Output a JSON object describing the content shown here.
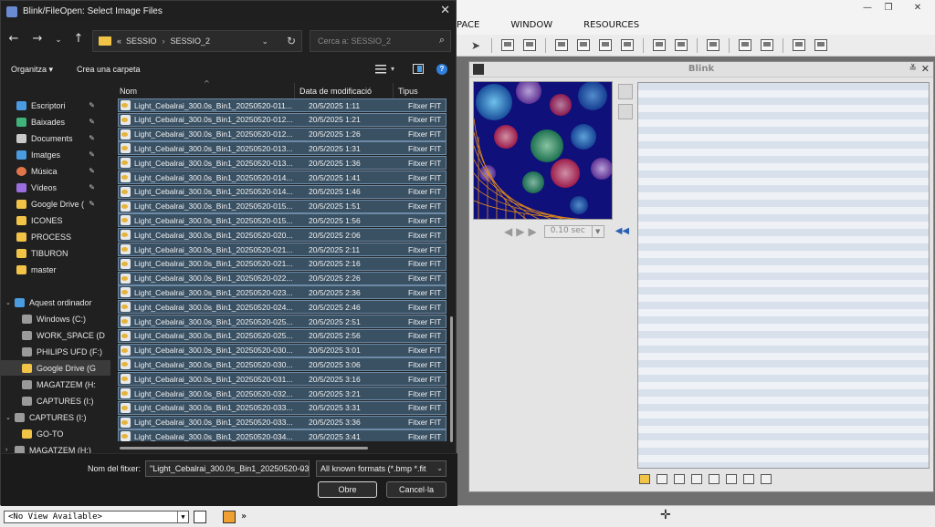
{
  "dialog": {
    "title": "Blink/FileOpen: Select Image Files",
    "address": {
      "prefix": "«",
      "parts": [
        "SESSIO",
        "SESSIO_2"
      ],
      "separator": "›"
    },
    "search_placeholder": "Cerca a: SESSIO_2",
    "command_bar": {
      "organize": "Organitza",
      "organize_caret": "▾",
      "new_folder": "Crea una carpeta"
    },
    "nav_pane": [
      {
        "label": "Escriptori",
        "pinned": true,
        "icon": "desktop-icon",
        "color": "#4a9be0"
      },
      {
        "label": "Baixades",
        "pinned": true,
        "icon": "download-icon",
        "color": "#3fb37a"
      },
      {
        "label": "Documents",
        "pinned": true,
        "icon": "document-icon",
        "color": "#c9c9c9"
      },
      {
        "label": "Imatges",
        "pinned": true,
        "icon": "image-icon",
        "color": "#4a9be0"
      },
      {
        "label": "Música",
        "pinned": true,
        "icon": "music-icon",
        "color": "#e0744a"
      },
      {
        "label": "Vídeos",
        "pinned": true,
        "icon": "video-icon",
        "color": "#9b6ee0"
      },
      {
        "label": "Google Drive (",
        "pinned": true,
        "icon": "google-drive-icon",
        "color": "#f1c447"
      },
      {
        "label": "ICONES",
        "pinned": false,
        "icon": "folder-icon",
        "color": "#f1c447"
      },
      {
        "label": "PROCESS",
        "pinned": false,
        "icon": "folder-icon",
        "color": "#f1c447"
      },
      {
        "label": "TIBURON",
        "pinned": false,
        "icon": "folder-icon",
        "color": "#f1c447"
      },
      {
        "label": "master",
        "pinned": false,
        "icon": "folder-icon",
        "color": "#f1c447"
      },
      {
        "label": "Aquest ordinador",
        "pinned": false,
        "icon": "computer-icon",
        "color": "#4a9be0"
      },
      {
        "label": "Windows (C:)",
        "pinned": false,
        "icon": "drive-icon",
        "color": "#9a9a9a"
      },
      {
        "label": "WORK_SPACE (D",
        "pinned": false,
        "icon": "drive-icon",
        "color": "#9a9a9a"
      },
      {
        "label": "PHILIPS UFD (F:)",
        "pinned": false,
        "icon": "usb-drive-icon",
        "color": "#9a9a9a"
      },
      {
        "label": "Google Drive (G",
        "pinned": false,
        "icon": "google-drive-icon",
        "color": "#f1c447",
        "selected": true
      },
      {
        "label": "MAGATZEM (H:",
        "pinned": false,
        "icon": "drive-icon",
        "color": "#9a9a9a"
      },
      {
        "label": "CAPTURES (I:)",
        "pinned": false,
        "icon": "drive-icon",
        "color": "#9a9a9a"
      },
      {
        "label": "CAPTURES (I:)",
        "pinned": false,
        "icon": "drive-icon",
        "color": "#9a9a9a"
      },
      {
        "label": "GO-TO",
        "pinned": false,
        "icon": "folder-icon",
        "color": "#f1c447"
      },
      {
        "label": "MAGATZEM (H:)",
        "pinned": false,
        "icon": "drive-icon",
        "color": "#9a9a9a"
      }
    ],
    "columns": {
      "name": "Nom",
      "date": "Data de modificació",
      "type": "Tipus"
    },
    "files": [
      {
        "name": "Light_Cebalrai_300.0s_Bin1_20250520-011...",
        "date": "20/5/2025 1:11",
        "type": "Fitxer FIT"
      },
      {
        "name": "Light_Cebalrai_300.0s_Bin1_20250520-012...",
        "date": "20/5/2025 1:21",
        "type": "Fitxer FIT"
      },
      {
        "name": "Light_Cebalrai_300.0s_Bin1_20250520-012...",
        "date": "20/5/2025 1:26",
        "type": "Fitxer FIT"
      },
      {
        "name": "Light_Cebalrai_300.0s_Bin1_20250520-013...",
        "date": "20/5/2025 1:31",
        "type": "Fitxer FIT"
      },
      {
        "name": "Light_Cebalrai_300.0s_Bin1_20250520-013...",
        "date": "20/5/2025 1:36",
        "type": "Fitxer FIT"
      },
      {
        "name": "Light_Cebalrai_300.0s_Bin1_20250520-014...",
        "date": "20/5/2025 1:41",
        "type": "Fitxer FIT"
      },
      {
        "name": "Light_Cebalrai_300.0s_Bin1_20250520-014...",
        "date": "20/5/2025 1:46",
        "type": "Fitxer FIT"
      },
      {
        "name": "Light_Cebalrai_300.0s_Bin1_20250520-015...",
        "date": "20/5/2025 1:51",
        "type": "Fitxer FIT"
      },
      {
        "name": "Light_Cebalrai_300.0s_Bin1_20250520-015...",
        "date": "20/5/2025 1:56",
        "type": "Fitxer FIT"
      },
      {
        "name": "Light_Cebalrai_300.0s_Bin1_20250520-020...",
        "date": "20/5/2025 2:06",
        "type": "Fitxer FIT"
      },
      {
        "name": "Light_Cebalrai_300.0s_Bin1_20250520-021...",
        "date": "20/5/2025 2:11",
        "type": "Fitxer FIT"
      },
      {
        "name": "Light_Cebalrai_300.0s_Bin1_20250520-021...",
        "date": "20/5/2025 2:16",
        "type": "Fitxer FIT"
      },
      {
        "name": "Light_Cebalrai_300.0s_Bin1_20250520-022...",
        "date": "20/5/2025 2:26",
        "type": "Fitxer FIT"
      },
      {
        "name": "Light_Cebalrai_300.0s_Bin1_20250520-023...",
        "date": "20/5/2025 2:36",
        "type": "Fitxer FIT"
      },
      {
        "name": "Light_Cebalrai_300.0s_Bin1_20250520-024...",
        "date": "20/5/2025 2:46",
        "type": "Fitxer FIT"
      },
      {
        "name": "Light_Cebalrai_300.0s_Bin1_20250520-025...",
        "date": "20/5/2025 2:51",
        "type": "Fitxer FIT"
      },
      {
        "name": "Light_Cebalrai_300.0s_Bin1_20250520-025...",
        "date": "20/5/2025 2:56",
        "type": "Fitxer FIT"
      },
      {
        "name": "Light_Cebalrai_300.0s_Bin1_20250520-030...",
        "date": "20/5/2025 3:01",
        "type": "Fitxer FIT"
      },
      {
        "name": "Light_Cebalrai_300.0s_Bin1_20250520-030...",
        "date": "20/5/2025 3:06",
        "type": "Fitxer FIT"
      },
      {
        "name": "Light_Cebalrai_300.0s_Bin1_20250520-031...",
        "date": "20/5/2025 3:16",
        "type": "Fitxer FIT"
      },
      {
        "name": "Light_Cebalrai_300.0s_Bin1_20250520-032...",
        "date": "20/5/2025 3:21",
        "type": "Fitxer FIT"
      },
      {
        "name": "Light_Cebalrai_300.0s_Bin1_20250520-033...",
        "date": "20/5/2025 3:31",
        "type": "Fitxer FIT"
      },
      {
        "name": "Light_Cebalrai_300.0s_Bin1_20250520-033...",
        "date": "20/5/2025 3:36",
        "type": "Fitxer FIT"
      },
      {
        "name": "Light_Cebalrai_300.0s_Bin1_20250520-034...",
        "date": "20/5/2025 3:41",
        "type": "Fitxer FIT"
      }
    ],
    "footer": {
      "filename_label": "Nom del fitxer:",
      "filename_value": "\"Light_Cebalrai_300.0s_Bin1_20250520-03",
      "filter_value": "All known formats (*.bmp *.fit",
      "open_button": "Obre",
      "cancel_button": "Cancel·la"
    }
  },
  "app": {
    "menu": [
      "PACE",
      "WINDOW",
      "RESOURCES"
    ],
    "blink_window": {
      "title": "Blink",
      "speed": "0.10 sec"
    },
    "statusbar": {
      "view_selector": "<No View Available>",
      "more": "»"
    },
    "colors": {
      "file_row_bg": "#3a5164",
      "file_row_border": "#6d8aa6",
      "accent_blue": "#2f7fdb"
    }
  }
}
